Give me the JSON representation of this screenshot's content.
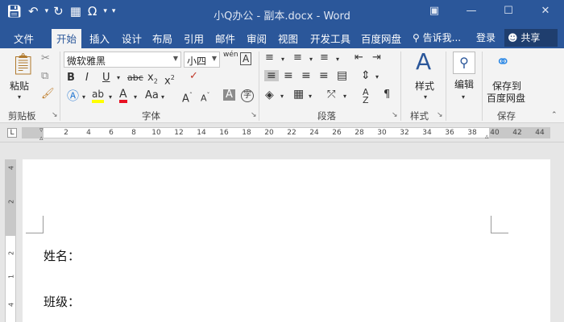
{
  "window": {
    "title": "小Q办公 - 副本.docx - Word",
    "minimize_icon": "minimize-icon",
    "maximize_icon": "maximize-icon",
    "close_icon": "close-icon",
    "options_icon": "ribbon-display-options-icon"
  },
  "qat": {
    "save_icon": "save-icon",
    "undo_icon": "undo-icon",
    "redo_icon": "redo-icon",
    "form_icon": "form-icon",
    "symbol_icon": "omega-icon",
    "customize_icon": "customize-qat-icon"
  },
  "tabs": [
    {
      "label": "文件",
      "active": false
    },
    {
      "label": "开始",
      "active": true
    },
    {
      "label": "插入",
      "active": false
    },
    {
      "label": "设计",
      "active": false
    },
    {
      "label": "布局",
      "active": false
    },
    {
      "label": "引用",
      "active": false
    },
    {
      "label": "邮件",
      "active": false
    },
    {
      "label": "审阅",
      "active": false
    },
    {
      "label": "视图",
      "active": false
    },
    {
      "label": "开发工具",
      "active": false
    },
    {
      "label": "百度网盘",
      "active": false
    }
  ],
  "tellme": "告诉我...",
  "login": "登录",
  "share": "共享",
  "ribbon": {
    "clipboard": {
      "label": "剪贴板",
      "paste": "粘贴"
    },
    "font": {
      "label": "字体",
      "font_name": "微软雅黑",
      "font_size": "小四",
      "wen_glyph": "wén",
      "A_glyph": "A"
    },
    "paragraph": {
      "label": "段落"
    },
    "styles": {
      "label": "样式",
      "button": "样式"
    },
    "editing": {
      "button": "编辑"
    },
    "save": {
      "label": "保存",
      "button_line1": "保存到",
      "button_line2": "百度网盘"
    }
  },
  "ruler": {
    "tab_marker": "L",
    "ticks": [
      "2",
      "4",
      "6",
      "8",
      "10",
      "12",
      "14",
      "16",
      "18",
      "20",
      "22",
      "24",
      "26",
      "28",
      "30",
      "32",
      "34",
      "36",
      "38",
      "40",
      "42",
      "44"
    ],
    "vertical_ticks": [
      "4",
      "2",
      "2",
      "1",
      "4"
    ]
  },
  "document": {
    "lines": [
      "姓名：",
      "班级："
    ]
  },
  "colors": {
    "accent": "#2b579a",
    "highlight": "#ffff00",
    "font_color": "#e81123"
  }
}
